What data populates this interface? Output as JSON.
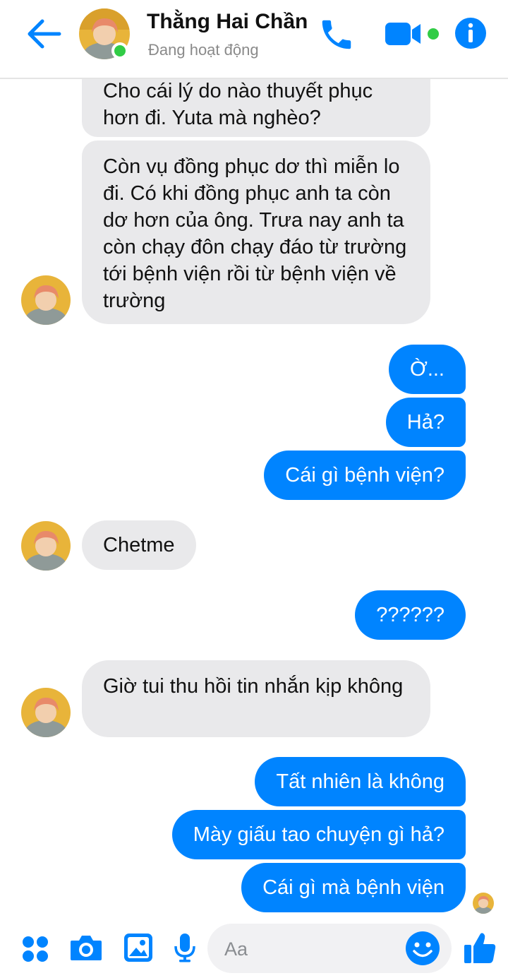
{
  "header": {
    "name": "Thằng Hai Chần",
    "status": "Đang hoạt động",
    "back_icon": "arrow-left-icon",
    "call_icon": "phone-icon",
    "video_icon": "video-camera-icon",
    "info_icon": "info-icon"
  },
  "messages": [
    {
      "side": "in",
      "text": "Cho cái lý do nào thuyết phục hơn đi. Yuta mà nghèo?"
    },
    {
      "side": "in",
      "text": " Còn vụ đồng phục dơ thì miễn lo đi. Có khi đồng phục anh ta còn dơ hơn của ông. Trưa nay anh ta còn chạy đôn chạy đáo từ trường tới bệnh viện rồi từ bệnh viện về trường"
    },
    {
      "side": "out",
      "text": "Ờ..."
    },
    {
      "side": "out",
      "text": "Hả?"
    },
    {
      "side": "out",
      "text": "Cái gì bệnh viện?"
    },
    {
      "side": "in",
      "text": "Chetme"
    },
    {
      "side": "out",
      "text": "??????"
    },
    {
      "side": "in",
      "text": "Giờ tui thu hồi tin nhắn kịp không"
    },
    {
      "side": "out",
      "text": "Tất nhiên là không"
    },
    {
      "side": "out",
      "text": "Mày giấu tao chuyện gì hả?"
    },
    {
      "side": "out",
      "text": "Cái gì mà bệnh viện"
    }
  ],
  "composer": {
    "placeholder": "Aa",
    "icons": [
      "apps-icon",
      "camera-icon",
      "image-icon",
      "microphone-icon",
      "emoji-icon",
      "thumbs-up-icon"
    ]
  },
  "colors": {
    "accent": "#0084ff",
    "incoming_bubble": "#e9e9eb",
    "online": "#31cc46"
  }
}
